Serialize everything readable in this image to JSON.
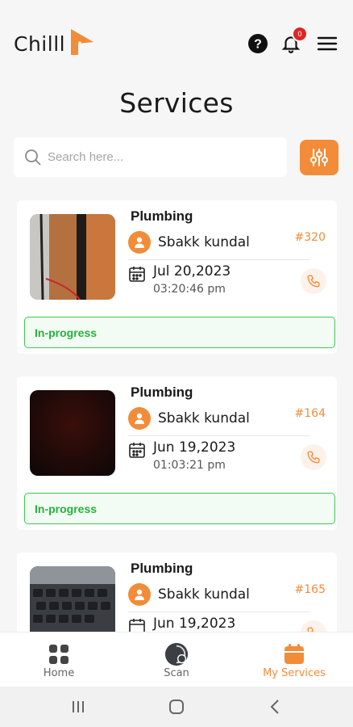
{
  "app": {
    "logo_text": "Chilll",
    "accent": "#f28c38"
  },
  "header": {
    "notification_count": "0"
  },
  "page": {
    "title": "Services"
  },
  "search": {
    "placeholder": "Search here..."
  },
  "services": [
    {
      "service": "Plumbing",
      "customer": "Sbakk kundal",
      "order_no": "#320",
      "date": "Jul 20,2023",
      "time": "03:20:46 pm",
      "status": "In-progress"
    },
    {
      "service": "Plumbing",
      "customer": "Sbakk kundal",
      "order_no": "#164",
      "date": "Jun 19,2023",
      "time": "01:03:21 pm",
      "status": "In-progress"
    },
    {
      "service": "Plumbing",
      "customer": "Sbakk kundal",
      "order_no": "#165",
      "date": "Jun 19,2023",
      "time": "",
      "status": ""
    }
  ],
  "bottom_nav": [
    {
      "label": "Home"
    },
    {
      "label": "Scan"
    },
    {
      "label": "My Services",
      "active": true
    }
  ]
}
